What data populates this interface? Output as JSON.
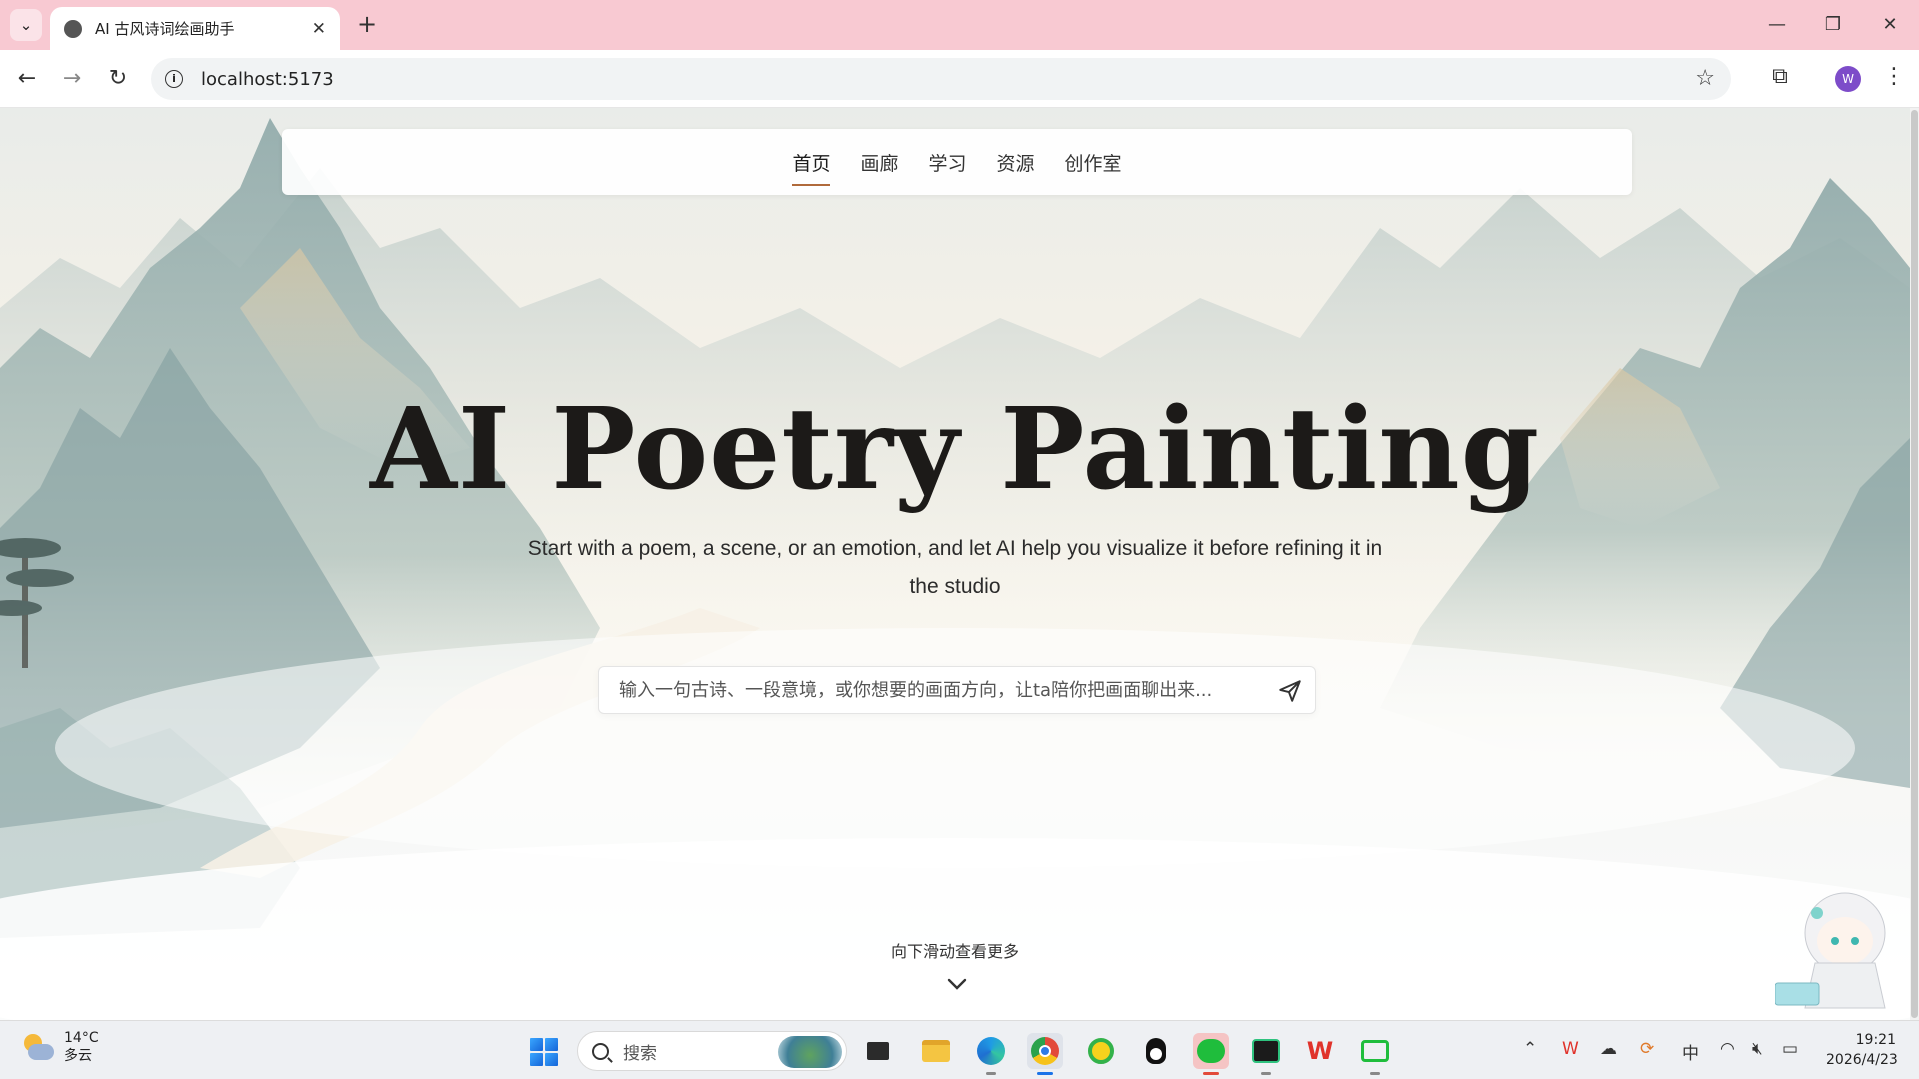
{
  "browser": {
    "tab_title": "AI 古风诗词绘画助手",
    "tab_close": "✕",
    "new_tab": "+",
    "url": "localhost:5173",
    "profile_initial": "W",
    "window_controls": {
      "minimize": "—",
      "restore": "❐",
      "close": "✕"
    }
  },
  "nav": {
    "items": [
      {
        "label": "首页",
        "active": true
      },
      {
        "label": "画廊",
        "active": false
      },
      {
        "label": "学习",
        "active": false
      },
      {
        "label": "资源",
        "active": false
      },
      {
        "label": "创作室",
        "active": false
      }
    ]
  },
  "hero": {
    "title": "AI Poetry Painting",
    "subtitle": "Start with a poem, a scene, or an emotion, and let AI help you visualize it before refining it in the studio"
  },
  "chat": {
    "placeholder": "输入一句古诗、一段意境，或你想要的画面方向，让ta陪你把画面聊出来..."
  },
  "scroll_hint": "向下滑动查看更多",
  "taskbar": {
    "weather_temp": "14°C",
    "weather_desc": "多云",
    "search_label": "搜索",
    "ime": "中",
    "time": "19:21",
    "date": "2026/4/23"
  },
  "colors": {
    "tab_strip": "#f8c9d2",
    "nav_underline": "#b06a3b",
    "mountain_teal": "#9fb7b6",
    "mountain_ochre": "#d9c7a3"
  }
}
